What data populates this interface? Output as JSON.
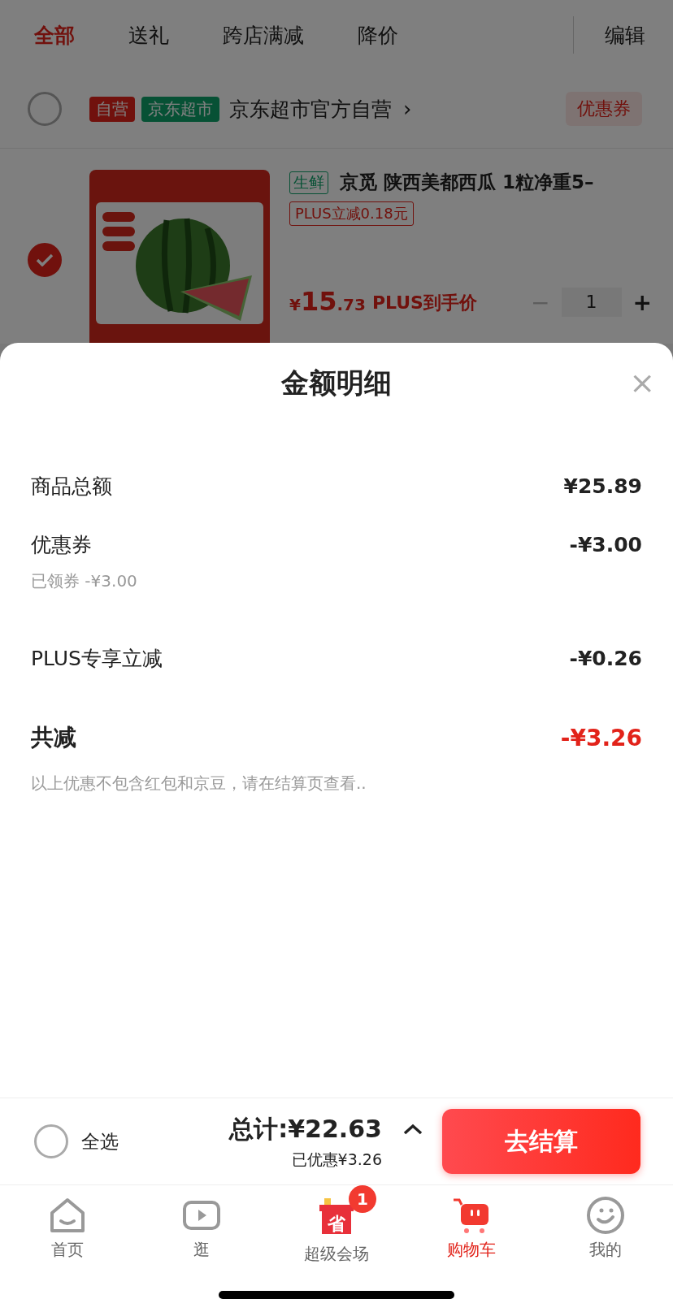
{
  "filter_tabs": [
    {
      "label": "全部",
      "selected": true
    },
    {
      "label": "送礼",
      "selected": false
    },
    {
      "label": "跨店满减",
      "selected": false
    },
    {
      "label": "降价",
      "selected": false
    }
  ],
  "edit_button": "编辑",
  "store": {
    "checked": false,
    "badges": [
      {
        "label": "自营",
        "kind": "self"
      },
      {
        "label": "京东超市",
        "kind": "market"
      }
    ],
    "name": "京东超市官方自营",
    "chevron": "›",
    "coupon_button": "优惠券"
  },
  "product": {
    "checked": true,
    "tag": "生鲜",
    "title": "京觅 陕西美都西瓜 1粒净重5–",
    "promo": "PLUS立减0.18元",
    "price_symbol": "¥",
    "price_int": "15",
    "price_dec": ".73",
    "price_label": "PLUS到手价",
    "minus": "−",
    "quantity": "1",
    "plus": "+"
  },
  "sheet": {
    "title": "金额明细",
    "close": "×",
    "rows": [
      {
        "label": "商品总额",
        "value": "¥25.89"
      },
      {
        "label": "优惠券",
        "value": "-¥3.00",
        "note": "已领券 -¥3.00"
      },
      {
        "label": "PLUS专享立减",
        "value": "-¥0.26"
      }
    ],
    "total": {
      "label": "共减",
      "value": "-¥3.26"
    },
    "disclaimer": "以上优惠不包含红包和京豆，请在结算页查看.."
  },
  "checkout": {
    "select_all": {
      "label": "全选",
      "checked": false
    },
    "total": "总计:¥22.63",
    "saved": "已优惠¥3.26",
    "button": "去结算"
  },
  "bottom_nav": [
    {
      "label": "首页",
      "kind": "home",
      "selected": false
    },
    {
      "label": "逛",
      "kind": "video",
      "selected": false
    },
    {
      "label": "超级会场",
      "kind": "gift",
      "selected": false,
      "icon_text": "省",
      "badge": "1"
    },
    {
      "label": "购物车",
      "kind": "cart",
      "selected": true
    },
    {
      "label": "我的",
      "kind": "smile",
      "selected": false
    }
  ]
}
